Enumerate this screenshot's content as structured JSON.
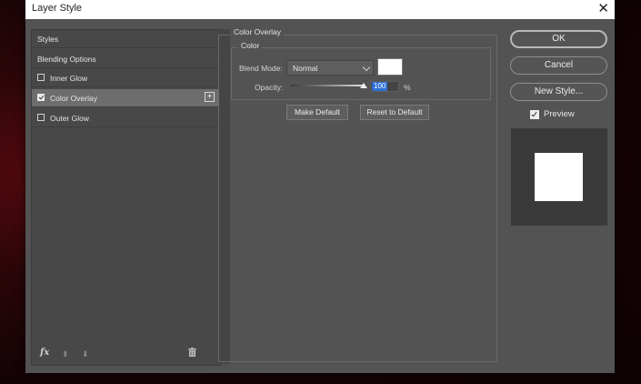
{
  "window": {
    "title": "Layer Style",
    "close_glyph": "✕"
  },
  "sidebar": {
    "header": "Styles",
    "items": [
      {
        "label": "Blending Options",
        "has_checkbox": false,
        "checked": false
      },
      {
        "label": "Inner Glow",
        "has_checkbox": true,
        "checked": false
      },
      {
        "label": "Color Overlay",
        "has_checkbox": true,
        "checked": true,
        "selected": true
      },
      {
        "label": "Outer Glow",
        "has_checkbox": true,
        "checked": false
      }
    ],
    "add_glyph": "+",
    "footer_icons": {
      "fx": "fx",
      "move_up": "⬆",
      "move_down": "⬇",
      "delete_icon": "trash-icon"
    }
  },
  "color_overlay": {
    "section_title": "Color Overlay",
    "group_title": "Color",
    "blend_mode": {
      "label": "Blend Mode:",
      "value": "Normal"
    },
    "color_swatch": "#ffffff",
    "opacity": {
      "label": "Opacity:",
      "value": "100",
      "unit": "%",
      "slider_fraction": 1.0
    },
    "make_default_label": "Make Default",
    "reset_default_label": "Reset to Default"
  },
  "actions": {
    "ok_label": "OK",
    "cancel_label": "Cancel",
    "new_style_label": "New Style..."
  },
  "preview": {
    "label": "Preview",
    "checked": true,
    "swatch_color": "#ffffff"
  }
}
